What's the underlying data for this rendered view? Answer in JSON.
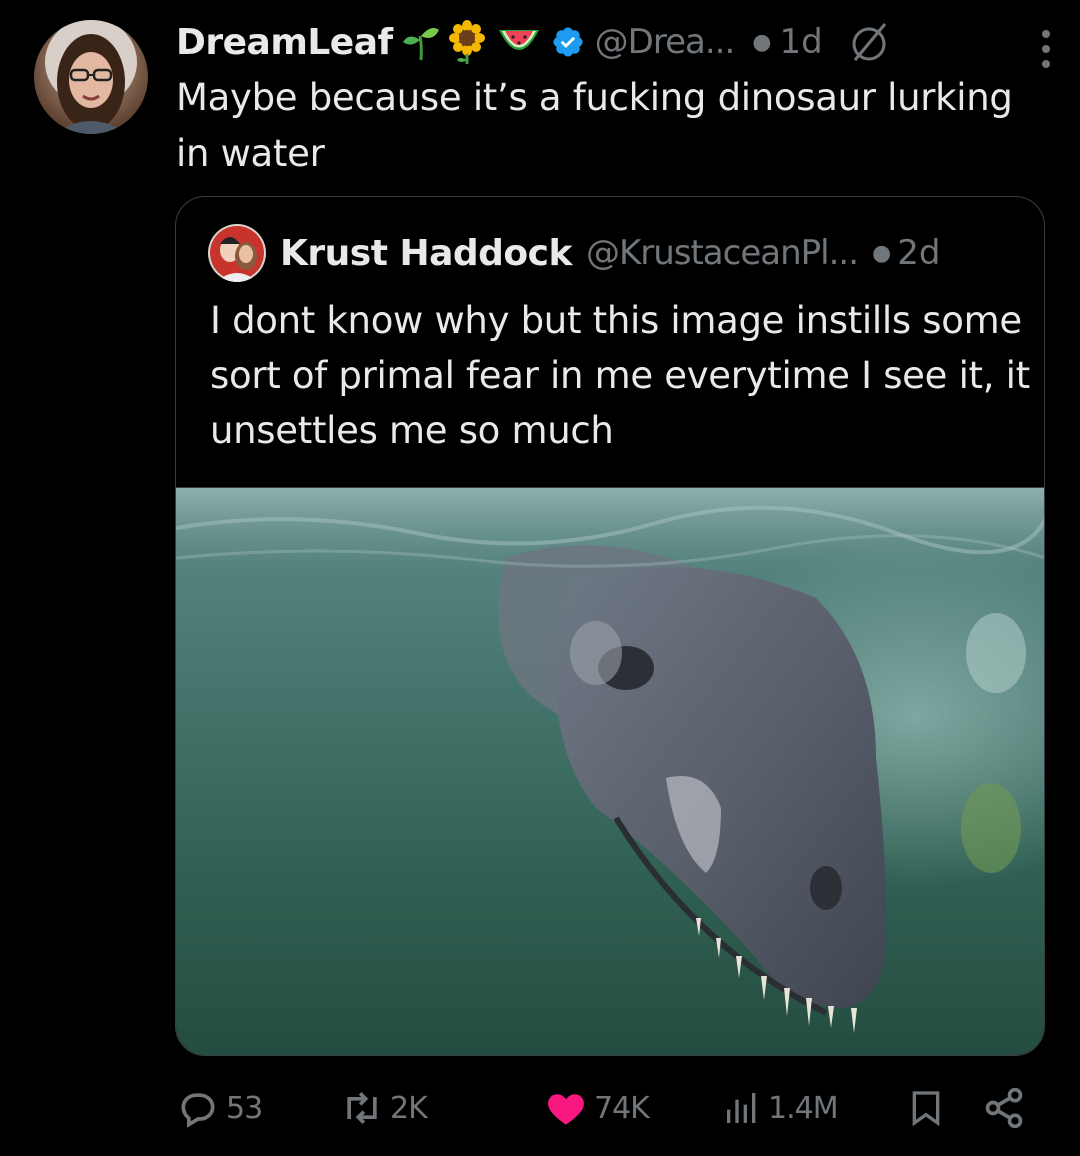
{
  "tweet": {
    "display_name": "DreamLeaf",
    "name_emojis": [
      "seedling-emoji",
      "sunflower-emoji",
      "watermelon-emoji"
    ],
    "handle": "@Drea...",
    "time": "1d",
    "text": "Maybe because it’s a fucking dinosaur lurking in water"
  },
  "quoted": {
    "display_name": "Krust Haddock",
    "handle": "@KrustaceanPl...",
    "time": "2d",
    "text": "I dont know why but this image instills some sort of primal fear in me everytime I see it, it unsettles me so much",
    "image_icon": "underwater-dinosaur-photo"
  },
  "actions": {
    "replies": "53",
    "reposts": "2K",
    "likes": "74K",
    "views": "1.4M"
  },
  "colors": {
    "background": "#000000",
    "text": "#e7e9ea",
    "secondary": "#71767b",
    "verified": "#1d9bf0",
    "like": "#f91880",
    "border": "#3a3d41"
  }
}
